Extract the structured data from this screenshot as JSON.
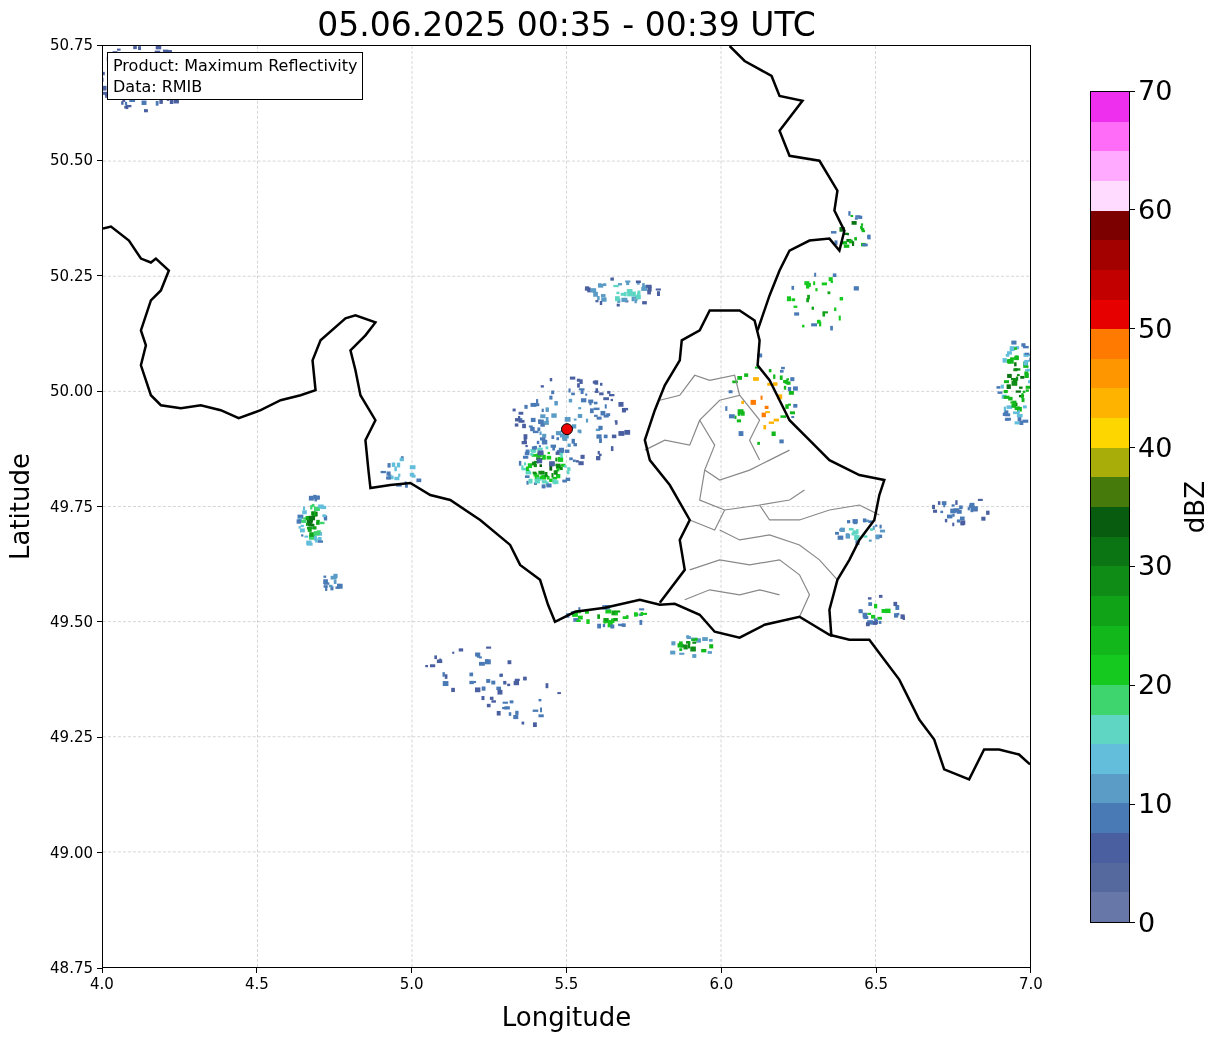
{
  "title": "05.06.2025 00:35 - 00:39 UTC",
  "info_box": [
    "Product: Maximum Reflectivity",
    "Data: RMIB"
  ],
  "axes": {
    "xlabel": "Longitude",
    "ylabel": "Latitude",
    "xticks": [
      "4.0",
      "4.5",
      "5.0",
      "5.5",
      "6.0",
      "6.5",
      "7.0"
    ],
    "yticks": [
      "50.75",
      "50.50",
      "50.25",
      "50.00",
      "49.75",
      "49.50",
      "49.25",
      "49.00",
      "48.75"
    ]
  },
  "colorbar": {
    "label": "dBZ",
    "ticks": [
      "70",
      "60",
      "50",
      "40",
      "30",
      "20",
      "10",
      "0"
    ],
    "segments": [
      {
        "color": "#6677a8"
      },
      {
        "color": "#56699e"
      },
      {
        "color": "#4a5fa0"
      },
      {
        "color": "#4a7ab5"
      },
      {
        "color": "#5a9cc5"
      },
      {
        "color": "#62bedb"
      },
      {
        "color": "#5fd6c3"
      },
      {
        "color": "#3ed46e"
      },
      {
        "color": "#16c91f"
      },
      {
        "color": "#12b81b"
      },
      {
        "color": "#11a317"
      },
      {
        "color": "#0e8c15"
      },
      {
        "color": "#0b7413"
      },
      {
        "color": "#075c10"
      },
      {
        "color": "#467a0b"
      },
      {
        "color": "#a8ad0a"
      },
      {
        "color": "#fdd600"
      },
      {
        "color": "#fdb300"
      },
      {
        "color": "#fe9600"
      },
      {
        "color": "#fe7a00"
      },
      {
        "color": "#e60000"
      },
      {
        "color": "#c20000"
      },
      {
        "color": "#a30000"
      },
      {
        "color": "#7d0000"
      },
      {
        "color": "#ffdcff"
      },
      {
        "color": "#ffaaff"
      },
      {
        "color": "#ff6cf8"
      },
      {
        "color": "#ee30ee"
      }
    ]
  }
}
